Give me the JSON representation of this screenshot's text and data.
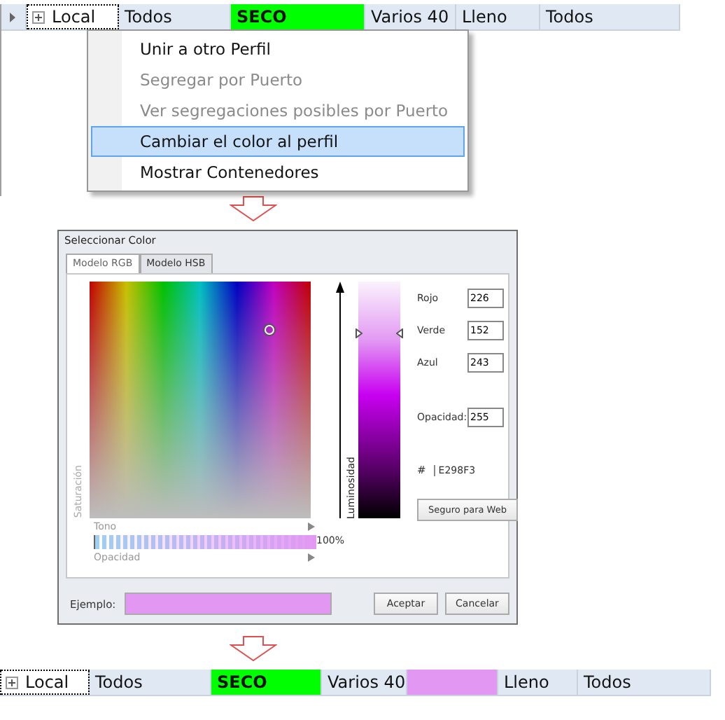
{
  "grid_before": {
    "current": true,
    "cells": [
      {
        "text": "Local",
        "kind": "tree",
        "focused": true
      },
      {
        "text": "Todos",
        "kind": "text"
      },
      {
        "text": "SECO",
        "kind": "swatch",
        "color": "#00ff00"
      },
      {
        "text": "Varios 40",
        "kind": "text"
      },
      {
        "text": "Lleno",
        "kind": "text"
      },
      {
        "text": "Todos",
        "kind": "text"
      }
    ]
  },
  "context_menu": {
    "items": [
      {
        "label": "Unir a otro Perfil",
        "disabled": false,
        "selected": false
      },
      {
        "label": "Segregar por Puerto",
        "disabled": true,
        "selected": false
      },
      {
        "label": "Ver segregaciones posibles por Puerto",
        "disabled": true,
        "selected": false
      },
      {
        "label": "Cambiar el color al perfil",
        "disabled": false,
        "selected": true
      },
      {
        "label": "Mostrar Contenedores",
        "disabled": false,
        "selected": false
      }
    ]
  },
  "dialog": {
    "title": "Seleccionar Color",
    "tabs": [
      {
        "label": "Modelo RGB",
        "selected": true
      },
      {
        "label": "Modelo HSB",
        "selected": false
      }
    ],
    "saturation_label": "Saturación",
    "hue_label": "Tono",
    "opacity_label": "Opacidad",
    "luminosity_label": "Luminosidad",
    "luminosity": {
      "level": 0.78
    },
    "opacity": {
      "level": 1.0,
      "reading": "100%"
    },
    "fields": [
      {
        "label": "Rojo",
        "value": "226"
      },
      {
        "label": "Verde",
        "value": "152"
      },
      {
        "label": "Azul",
        "value": "243"
      },
      {
        "label": "Opacidad:",
        "value": "255"
      }
    ],
    "hex": {
      "prefix": "#",
      "value": "E298F3"
    },
    "web_safe_button": "Seguro para Web",
    "sample": {
      "label": "Ejemplo:",
      "color": "#e298f3"
    },
    "buttons": [
      "Aceptar",
      "Cancelar"
    ]
  },
  "grid_after": {
    "current": false,
    "cells": [
      {
        "text": "Local",
        "kind": "tree",
        "focused": true
      },
      {
        "text": "Todos",
        "kind": "text"
      },
      {
        "text": "SECO",
        "kind": "swatch",
        "color": "#00ff00"
      },
      {
        "text": "Varios 40",
        "kind": "text"
      },
      {
        "text": "",
        "kind": "swatch",
        "color": "#e298f3"
      },
      {
        "text": "Lleno",
        "kind": "text"
      },
      {
        "text": "Todos",
        "kind": "text"
      }
    ]
  }
}
